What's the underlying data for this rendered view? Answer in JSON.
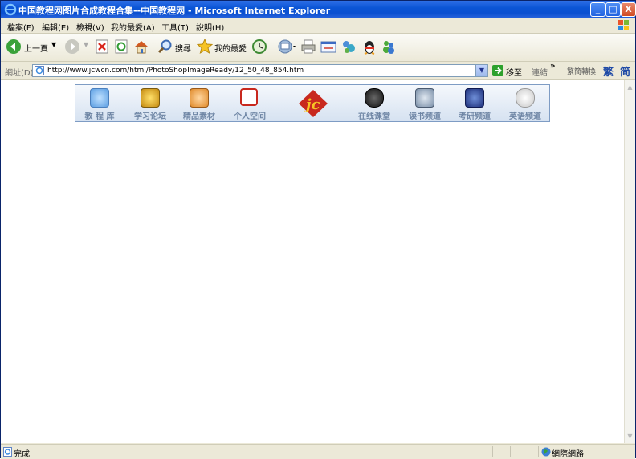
{
  "window": {
    "title": "中国教程网图片合成教程合集--中国教程网 - Microsoft Internet Explorer",
    "minimize": "_",
    "maximize": "□",
    "close": "X"
  },
  "menu": [
    "檔案(F)",
    "編輯(E)",
    "檢視(V)",
    "我的最愛(A)",
    "工具(T)",
    "說明(H)"
  ],
  "toolbar": {
    "back_label": "上一頁",
    "search_label": "搜尋",
    "favorites_label": "我的最愛"
  },
  "address": {
    "label": "網址(D)",
    "url": "http://www.jcwcn.com/html/PhotoShopImageReady/12_50_48_854.htm",
    "go_label": "移至",
    "links_label": "連結",
    "more": "»",
    "convert_label": "繁簡轉換",
    "trad": "繁",
    "simp": "简"
  },
  "nav": {
    "items": [
      "教 程 库",
      "学习论坛",
      "精品素材",
      "个人空间",
      "在线课堂",
      "读书频道",
      "考研频道",
      "英语频道"
    ],
    "logo_text": "jc"
  },
  "status": {
    "text": "完成",
    "zone": "網際網路"
  },
  "colors": {
    "titlebar": "#0b55d6",
    "nav_label": "#6f86a5",
    "logo": "#c8281e"
  }
}
